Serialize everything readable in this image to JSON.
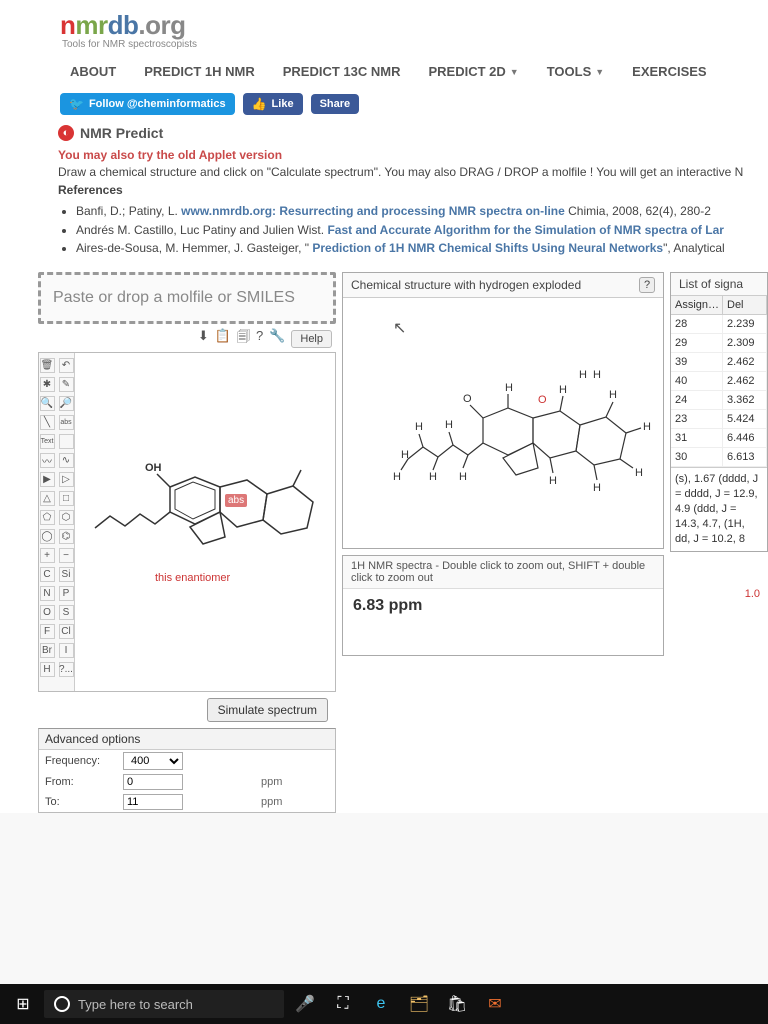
{
  "header": {
    "logo_n": "n",
    "logo_mr": "mr",
    "logo_db": "db",
    "logo_org": ".org",
    "tagline": "Tools for NMR spectroscopists"
  },
  "nav": {
    "about": "ABOUT",
    "predict1h": "PREDICT 1H NMR",
    "predict13c": "PREDICT 13C NMR",
    "predict2d": "PREDICT 2D",
    "tools": "TOOLS",
    "exercises": "EXERCISES"
  },
  "social": {
    "follow": "Follow @cheminformatics",
    "like": "Like",
    "share": "Share"
  },
  "section": {
    "title": "NMR Predict",
    "old_version": "You may also try the old Applet version",
    "instructions": "Draw a chemical structure and click on \"Calculate spectrum\". You may also DRAG / DROP a molfile ! You will get an interactive N",
    "references_label": "References"
  },
  "refs": {
    "r1a": "Banfi, D.; Patiny, L. ",
    "r1b": "www.nmrdb.org: Resurrecting and processing NMR spectra on-line",
    "r1c": " Chimia, 2008, 62(4), 280-2",
    "r2a": "Andrés M. Castillo, Luc Patiny and Julien Wist. ",
    "r2b": "Fast and Accurate Algorithm for the Simulation of NMR spectra of Lar",
    "r3a": "Aires-de-Sousa, M. Hemmer, J. Gasteiger, \" ",
    "r3b": "Prediction of 1H NMR Chemical Shifts Using Neural Networks",
    "r3c": "\", Analytical"
  },
  "editor": {
    "drop_placeholder": "Paste or drop a molfile or SMILES",
    "help": "Help",
    "oh": "OH",
    "abs": "abs",
    "enantiomer": "this enantiomer",
    "text_tool": "Text",
    "simulate": "Simulate spectrum",
    "atoms": {
      "c": "C",
      "si": "Si",
      "n": "N",
      "p": "P",
      "o": "O",
      "s": "S",
      "f": "F",
      "cl": "Cl",
      "br": "Br",
      "i": "I",
      "h": "H",
      "x": "?..."
    }
  },
  "adv": {
    "title": "Advanced options",
    "freq_label": "Frequency:",
    "freq_value": "400",
    "from_label": "From:",
    "from_value": "0",
    "to_label": "To:",
    "to_value": "11",
    "unit": "ppm"
  },
  "mid": {
    "exploded_title": "Chemical structure with hydrogen exploded",
    "spectra_hint": "1H NMR spectra - Double click to zoom out, SHIFT + double click to zoom out",
    "ppm": "6.83 ppm"
  },
  "signals": {
    "title": "List of signa",
    "col_assign": "Assign…",
    "col_delta": "Del",
    "rows": [
      {
        "a": "28",
        "d": "2.239"
      },
      {
        "a": "29",
        "d": "2.309"
      },
      {
        "a": "39",
        "d": "2.462"
      },
      {
        "a": "40",
        "d": "2.462"
      },
      {
        "a": "24",
        "d": "3.362"
      },
      {
        "a": "23",
        "d": "5.424"
      },
      {
        "a": "31",
        "d": "6.446"
      },
      {
        "a": "30",
        "d": "6.613"
      }
    ],
    "couplings": "(s), 1.67 (dddd, J =\ndddd, J = 12.9, 4.9\n(ddd, J = 14.3, 4.7,\n(1H, dd, J = 10.2, 8",
    "one": "1.0"
  },
  "taskbar": {
    "search_placeholder": "Type here to search"
  }
}
